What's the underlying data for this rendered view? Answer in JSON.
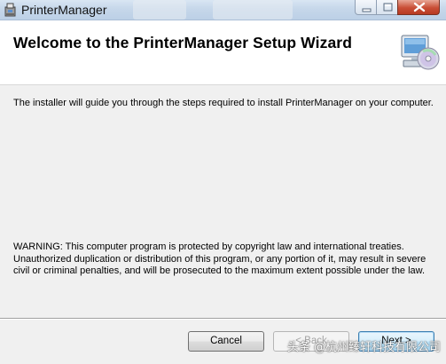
{
  "window": {
    "title": "PrinterManager",
    "title_icon": "installer-package-icon"
  },
  "header": {
    "title": "Welcome to the PrinterManager Setup Wizard",
    "icon": "computer-cd-icon"
  },
  "content": {
    "intro": "The installer will guide you through the steps required to install PrinterManager on your computer.",
    "warning": "WARNING: This computer program is protected by copyright law and international treaties. Unauthorized duplication or distribution of this program, or any portion of it, may result in severe civil or criminal penalties, and will be prosecuted to the maximum extent possible under the law."
  },
  "buttons": {
    "cancel": "Cancel",
    "back": "< Back",
    "next": "Next >",
    "back_enabled": false
  },
  "overlay": {
    "watermark": "头条 @杭州臻轩科技有限公司"
  },
  "colors": {
    "title_bar": "#c6d7ea",
    "dialog_bg": "#f0f0f0",
    "banner_bg": "#ffffff",
    "close_button": "#c94e36",
    "default_button_border": "#3c7fb1"
  }
}
